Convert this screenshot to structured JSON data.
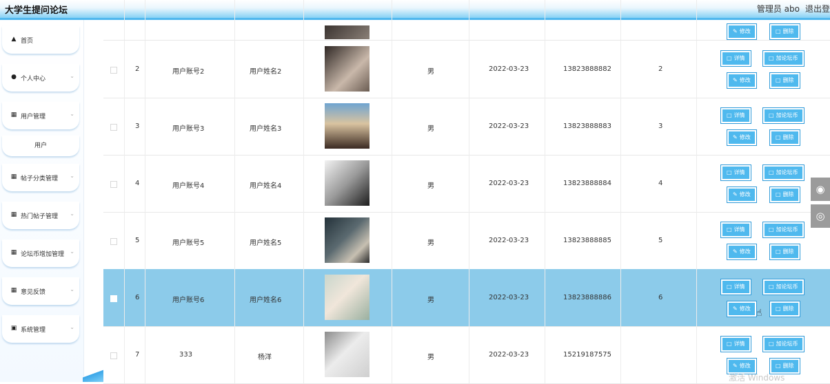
{
  "header": {
    "title": "大学生提问论坛",
    "user": "管理员 abo",
    "logout": "退出登"
  },
  "sidebar": {
    "items": [
      {
        "label": "首页",
        "icon": "home-icon"
      },
      {
        "label": "个人中心",
        "icon": "person-icon"
      },
      {
        "label": "用户管理",
        "icon": "grid-icon"
      },
      {
        "label": "帖子分类管理",
        "icon": "grid-icon"
      },
      {
        "label": "热门帖子管理",
        "icon": "grid-icon"
      },
      {
        "label": "论坛币增加管理",
        "icon": "grid-icon"
      },
      {
        "label": "意见反馈",
        "icon": "grid-icon"
      },
      {
        "label": "系统管理",
        "icon": "checkbox-icon"
      }
    ],
    "submenu_label": "用户"
  },
  "actions": {
    "detail": "详情",
    "add_coin": "加论坛币",
    "edit": "修改",
    "delete": "删除"
  },
  "rows": [
    {
      "id": "2",
      "account": "用户账号2",
      "name": "用户姓名2",
      "gender": "男",
      "date": "2022-03-23",
      "phone": "13823888882",
      "coins": "2"
    },
    {
      "id": "3",
      "account": "用户账号3",
      "name": "用户姓名3",
      "gender": "男",
      "date": "2022-03-23",
      "phone": "13823888883",
      "coins": "3"
    },
    {
      "id": "4",
      "account": "用户账号4",
      "name": "用户姓名4",
      "gender": "男",
      "date": "2022-03-23",
      "phone": "13823888884",
      "coins": "4"
    },
    {
      "id": "5",
      "account": "用户账号5",
      "name": "用户姓名5",
      "gender": "男",
      "date": "2022-03-23",
      "phone": "13823888885",
      "coins": "5"
    },
    {
      "id": "6",
      "account": "用户账号6",
      "name": "用户姓名6",
      "gender": "男",
      "date": "2022-03-23",
      "phone": "13823888886",
      "coins": "6"
    },
    {
      "id": "7",
      "account": "333",
      "name": "杨洋",
      "gender": "男",
      "date": "2022-03-23",
      "phone": "15219187575",
      "coins": ""
    }
  ],
  "partial_row": {
    "edit": "修改",
    "delete": "删除"
  },
  "watermark": "激活 Windows"
}
